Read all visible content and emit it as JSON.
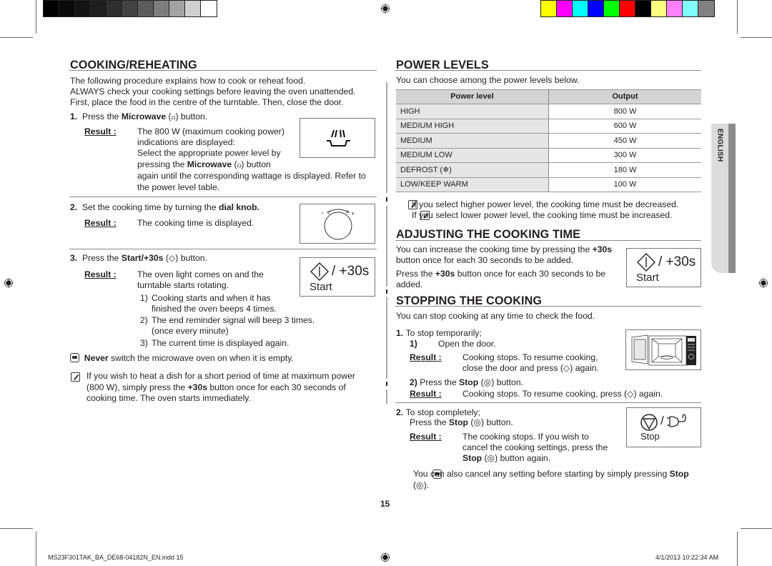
{
  "print_marks": {
    "gray_swatches": [
      "#000000",
      "#0a0a0a",
      "#141414",
      "#1e1e1e",
      "#2e2e2e",
      "#434343",
      "#5c5c5c",
      "#7d7d7d",
      "#a3a3a3",
      "#d0d0d0",
      "#ffffff"
    ],
    "color_swatches": [
      "#ffff00",
      "#ff00ff",
      "#00ffff",
      "#0000ff",
      "#00ff00",
      "#ff0000",
      "#000000",
      "#ffff80",
      "#ff80ff",
      "#80ffff",
      "#808080"
    ]
  },
  "left": {
    "title": "COOKING/REHEATING",
    "intro": [
      "The following procedure explains how to cook or reheat food.",
      "ALWAYS check your cooking settings before leaving the oven unattended.",
      "First, place the food in the centre of the turntable. Then, close the door."
    ],
    "step1": {
      "num": "1.",
      "pre": "Press the ",
      "bold": "Microwave",
      "post": " button.",
      "result_label": "Result :",
      "lines": [
        "The 800 W (maximum cooking power)",
        "indications are displayed:",
        "Select the appropriate power level by"
      ],
      "line4_pre": "pressing the ",
      "line4_bold": "Microwave",
      "line4_post": " button",
      "line5": "again until the corresponding wattage is displayed. Refer to",
      "line6": "the power level table."
    },
    "step2": {
      "num": "2.",
      "pre": "Set the cooking time by turning the ",
      "bold": "dial knob.",
      "result_label": "Result :",
      "result_text": "The cooking time is displayed.",
      "dial_minus": "-",
      "dial_plus": "+"
    },
    "step3": {
      "num": "3.",
      "pre": "Press the ",
      "bold": "Start/+30s",
      "post": " button.",
      "result_label": "Result :",
      "result_lines": [
        "The oven light comes on and the",
        "turntable starts rotating."
      ],
      "sub": [
        {
          "n": "1)",
          "lines": [
            "Cooking starts and when it has",
            "finished the oven beeps 4 times."
          ]
        },
        {
          "n": "2)",
          "lines": [
            "The end reminder signal will beep 3 times.",
            "(once every minute)"
          ]
        },
        {
          "n": "3)",
          "lines": [
            "The current time is displayed again."
          ]
        }
      ],
      "fig_slash": "/ +30s",
      "fig_label": "Start"
    },
    "warning": {
      "bold": "Never",
      "text": " switch the microwave oven on when it is empty."
    },
    "note": {
      "line1": "If you wish to heat a dish for a short period of time at maximum power",
      "line2_pre": "(800 W), simply press the ",
      "line2_bold": "+30s",
      "line2_post": " button once for each 30 seconds of",
      "line3": "cooking time. The oven starts immediately."
    }
  },
  "right": {
    "power_title": "POWER LEVELS",
    "power_intro": "You can choose among the power levels below.",
    "table": {
      "headers": [
        "Power level",
        "Output"
      ],
      "rows": [
        {
          "level": "HIGH",
          "output": "800 W"
        },
        {
          "level": "MEDIUM HIGH",
          "output": "600 W"
        },
        {
          "level": "MEDIUM",
          "output": "450 W"
        },
        {
          "level": "MEDIUM LOW",
          "output": "300 W"
        },
        {
          "level": "DEFROST (❄)",
          "output": "180 W"
        },
        {
          "level": "LOW/KEEP WARM",
          "output": "100 W"
        }
      ]
    },
    "notes": [
      "If you select higher power level, the cooking time must be decreased.",
      "If you select lower power level, the cooking time must be increased."
    ],
    "adjust_title": "ADJUSTING THE COOKING TIME",
    "adjust": {
      "l1_pre": "You can increase the cooking time by pressing the ",
      "l1_bold": "+30s",
      "l2": "button once for each 30 seconds to be added.",
      "l3_pre": "Press the ",
      "l3_bold": "+30s",
      "l3_post": " button once for each 30 seconds to be",
      "l4": "added.",
      "fig_slash": "/ +30s",
      "fig_label": "Start"
    },
    "stop_title": "STOPPING THE COOKING",
    "stop_intro": "You can stop cooking at any time to check the food.",
    "stop1": {
      "num": "1.",
      "text": "To stop temporarily;",
      "sub1_num": "1)",
      "sub1_text": "Open the door.",
      "result_label": "Result :",
      "result_lines": [
        "Cooking stops. To resume cooking,",
        "close the door and press (◇) again."
      ],
      "sub2_num": "2)",
      "sub2_pre": "Press the ",
      "sub2_bold": "Stop",
      "sub2_post": " (◎) button.",
      "result2_label": "Result :",
      "result2_text": "Cooking stops. To resume cooking, press (◇) again."
    },
    "stop2": {
      "num": "2.",
      "text": "To stop completely;",
      "l2_pre": "Press the ",
      "l2_bold": "Stop",
      "l2_post": " (◎) button.",
      "result_label": "Result :",
      "result_lines": [
        "The cooking stops. If you wish to",
        "cancel the cooking settings, press the"
      ],
      "result_l3_bold": "Stop",
      "result_l3_post": " (◎) button again.",
      "fig_label": "Stop",
      "fig_slash": "/"
    },
    "warning": {
      "l1_pre": "You can also cancel any setting before starting by simply pressing ",
      "l1_bold": "Stop",
      "l2": "(◎)."
    }
  },
  "language_tab": "ENGLISH",
  "page_number": "15",
  "footer": {
    "file": "MS23F301TAK_BA_DE68-04182N_EN.indd   15",
    "date": "4/1/2013   10:22:34 AM"
  }
}
